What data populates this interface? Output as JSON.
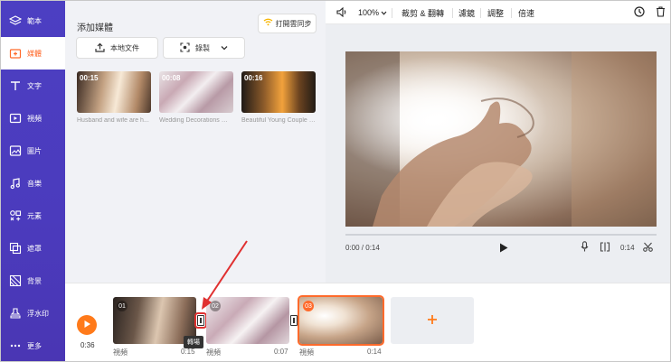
{
  "sidebar": {
    "items": [
      {
        "label": "範本",
        "icon": "layers-icon"
      },
      {
        "label": "媒體",
        "icon": "folder-add-icon",
        "active": true
      },
      {
        "label": "文字",
        "icon": "text-icon"
      },
      {
        "label": "視頻",
        "icon": "video-icon"
      },
      {
        "label": "圖片",
        "icon": "image-icon"
      },
      {
        "label": "音樂",
        "icon": "music-icon"
      },
      {
        "label": "元素",
        "icon": "elements-icon"
      },
      {
        "label": "遮罩",
        "icon": "overlay-icon"
      },
      {
        "label": "背景",
        "icon": "background-icon"
      },
      {
        "label": "浮水印",
        "icon": "stamp-icon"
      },
      {
        "label": "更多",
        "icon": "more-icon"
      }
    ]
  },
  "media": {
    "title": "添加媒體",
    "sync_label": "打開雲同步",
    "upload_label": "本地文件",
    "record_label": "錄製",
    "items": [
      {
        "duration": "00:15",
        "caption": "Husband and wife are h..."
      },
      {
        "duration": "00:08",
        "caption": "Wedding Decorations Wi..."
      },
      {
        "duration": "00:16",
        "caption": "Beautiful Young Couple i..."
      }
    ]
  },
  "toolbar": {
    "zoom": "100%",
    "crop_label": "裁剪 & 翻轉",
    "filter_label": "濾鏡",
    "adjust_label": "調整",
    "speed_label": "倍速"
  },
  "preview": {
    "time_current": "0:00 / 0:14",
    "time_end": "0:14"
  },
  "timeline": {
    "total": "0:36",
    "clips": [
      {
        "num": "01",
        "label": "視頻",
        "end": "0:15"
      },
      {
        "num": "02",
        "label": "視頻",
        "end": "0:07"
      },
      {
        "num": "03",
        "label": "視頻",
        "end": "0:14",
        "selected": true
      }
    ],
    "tooltip": "轉場"
  },
  "colors": {
    "sidebar": "#4b3bbd",
    "accent": "#ff6a2b",
    "annotation": "#e03030"
  }
}
